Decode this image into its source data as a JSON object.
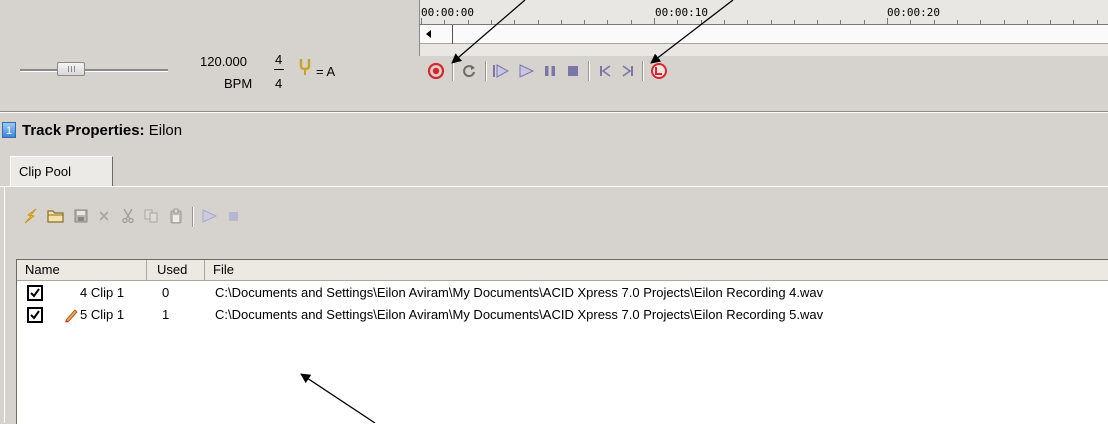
{
  "transport": {
    "tempo_value": "120.000",
    "tempo_unit": "BPM",
    "time_sig_top": "4",
    "time_sig_bottom": "4",
    "pitch_label": "= A",
    "timeline_marks": [
      "00:00:00",
      "00:00:10",
      "00:00:20"
    ],
    "buttons": [
      "record-icon",
      "loop-icon",
      "play-from-start-icon",
      "play-icon",
      "pause-icon",
      "stop-icon",
      "go-to-start-icon",
      "go-to-end-icon",
      "metronome-icon"
    ],
    "record_color": "#d9262c"
  },
  "track_properties": {
    "label_prefix": "Track Properties:",
    "track_name": "Eilon",
    "track_number": "1"
  },
  "tabs": [
    {
      "label": "Clip Pool",
      "active": true
    }
  ],
  "clip_toolbar": [
    "lightning-icon",
    "folder-open-icon",
    "save-icon",
    "delete-icon",
    "cut-icon",
    "copy-icon",
    "paste-icon",
    "play-icon",
    "stop-icon"
  ],
  "clip_list": {
    "columns": [
      "Name",
      "Used",
      "File"
    ],
    "rows": [
      {
        "checked": true,
        "recording": false,
        "name": "4 Clip 1",
        "used": "0",
        "file": "C:\\Documents and Settings\\Eilon Aviram\\My Documents\\ACID Xpress 7.0 Projects\\Eilon Recording 4.wav"
      },
      {
        "checked": true,
        "recording": true,
        "name": "5 Clip 1",
        "used": "1",
        "file": "C:\\Documents and Settings\\Eilon Aviram\\My Documents\\ACID Xpress 7.0 Projects\\Eilon Recording 5.wav"
      }
    ]
  }
}
